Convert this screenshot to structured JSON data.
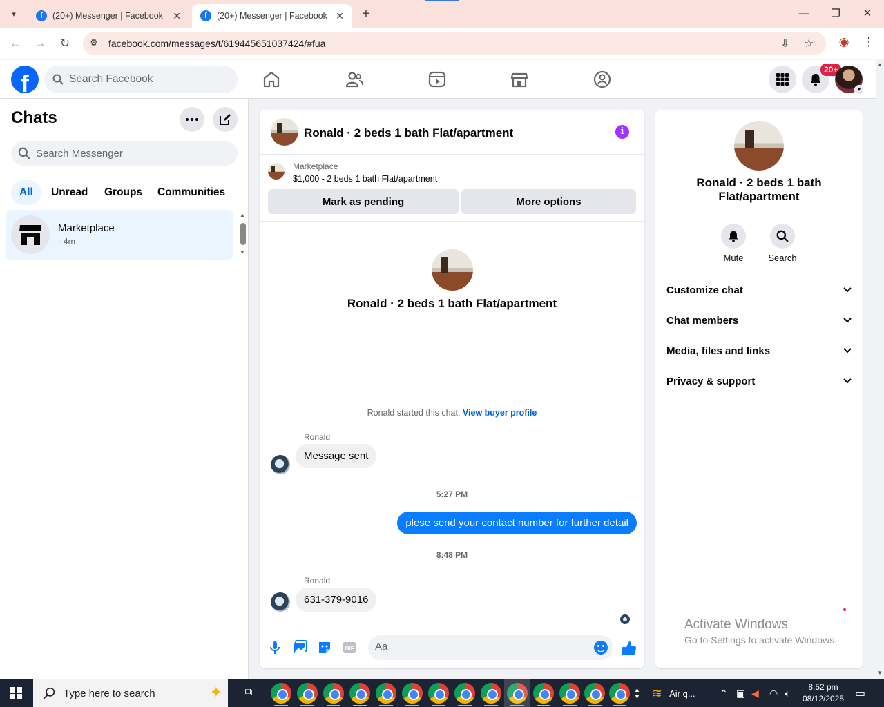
{
  "browser": {
    "tabs": [
      {
        "title": "(20+) Messenger | Facebook",
        "favicon": "facebook-icon"
      },
      {
        "title": "(20+) Messenger | Facebook",
        "favicon": "facebook-icon"
      }
    ],
    "url": "facebook.com/messages/t/619445651037424/#fua"
  },
  "fb_header": {
    "logo": "f",
    "search_placeholder": "Search Facebook",
    "notifications_badge": "20+",
    "nav_icons": [
      "home-icon",
      "friends-icon",
      "video-icon",
      "marketplace-icon",
      "groups-icon"
    ]
  },
  "sidebar": {
    "title": "Chats",
    "search_placeholder": "Search Messenger",
    "filters": [
      "All",
      "Unread",
      "Groups",
      "Communities"
    ],
    "chats": [
      {
        "name": "Marketplace",
        "time": "· 4m"
      }
    ]
  },
  "conversation": {
    "title": "Ronald · 2 beds 1 bath Flat/apartment",
    "marketplace": {
      "label": "Marketplace",
      "listing": "$1,000 - 2 beds 1 bath Flat/apartment",
      "mark_pending": "Mark as pending",
      "more_options": "More options"
    },
    "intro_name": "Ronald · 2 beds 1 bath Flat/apartment",
    "started_text": "Ronald started this chat.",
    "view_buyer_profile": "View buyer profile",
    "messages": [
      {
        "sender": "Ronald",
        "text": "Message sent"
      },
      {
        "time": "5:27 PM"
      },
      {
        "text": "plese send your contact number for further detail"
      },
      {
        "time": "8:48 PM"
      },
      {
        "sender": "Ronald",
        "text": "631-379-9016"
      }
    ],
    "composer_placeholder": "Aa"
  },
  "details": {
    "name": "Ronald · 2 beds 1 bath Flat/apartment",
    "actions": [
      "Mute",
      "Search"
    ],
    "sections": [
      "Customize chat",
      "Chat members",
      "Media, files and links",
      "Privacy & support"
    ]
  },
  "watermark": {
    "line1": "Activate Windows",
    "line2": "Go to Settings to activate Windows."
  },
  "taskbar": {
    "search_placeholder": "Type here to search",
    "weather": "Air q...",
    "time": "8:52 pm",
    "date": "08/12/2025"
  },
  "colors": {
    "facebook_blue": "#0866ff",
    "outgoing_bubble": "#0a7cff",
    "info_purple": "#a033ff",
    "badge_red": "#e41e3f"
  }
}
